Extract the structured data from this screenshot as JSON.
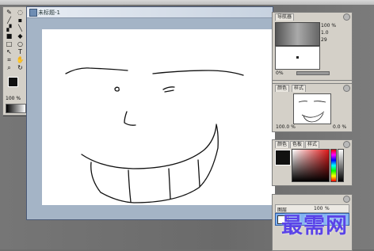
{
  "document": {
    "title": "未标题-1"
  },
  "panels": {
    "navigator": {
      "tabs": [
        "导航器"
      ],
      "opacity_label": "100",
      "percent_label": "%",
      "value_1": "1.0",
      "value_2": "29",
      "zoom_percent": "0%"
    },
    "layers": {
      "label": "图层"
    },
    "preview": {
      "tabs": [
        "颜色",
        "样式"
      ],
      "zoom": "100.0",
      "zoom_unit": "%",
      "value": "0.0",
      "value_unit": "%"
    },
    "color": {
      "tabs": [
        "颜色",
        "色板",
        "样式"
      ]
    },
    "bottom": {
      "label": "图层",
      "opacity": "100",
      "unit": "%"
    }
  },
  "toolbox": {
    "zoom_value": "100",
    "zoom_unit": "%"
  },
  "watermark": {
    "text": "最需网"
  },
  "colors": {
    "canvas": "#ffffff",
    "panel": "#d4d0c8",
    "watermark": "#5a43e8"
  }
}
